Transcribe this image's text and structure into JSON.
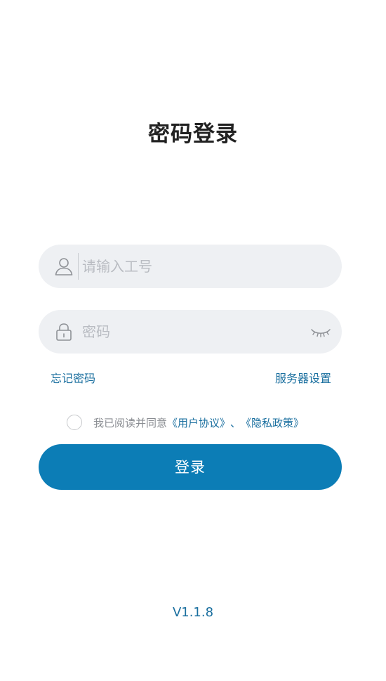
{
  "page": {
    "title": "密码登录"
  },
  "form": {
    "username_placeholder": "请输入工号",
    "username_value": "",
    "password_placeholder": "密码",
    "password_value": ""
  },
  "links": {
    "forgot_password": "忘记密码",
    "server_settings": "服务器设置"
  },
  "agreement": {
    "prefix": "我已阅读并同意",
    "user_agreement": "《用户协议》",
    "separator": "、",
    "privacy_policy": "《隐私政策》",
    "checked": false
  },
  "login_button": "登录",
  "version": "V1.1.8",
  "icons": {
    "username": "user-icon",
    "password": "lock-icon",
    "visibility": "eye-closed-icon"
  },
  "colors": {
    "primary": "#0c7db6",
    "link": "#1a6f9f",
    "field_bg": "#eef0f3",
    "placeholder": "#b9bcc2"
  }
}
